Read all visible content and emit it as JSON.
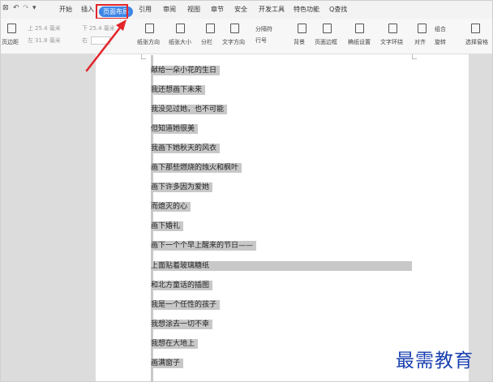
{
  "quick_access": {
    "undo": "↶",
    "redo": "↷",
    "more": "▾"
  },
  "menu_tabs": [
    "开始",
    "插入",
    "页面布局",
    "引用",
    "审阅",
    "视图",
    "章节",
    "安全",
    "开发工具",
    "特色功能",
    "Q查找"
  ],
  "active_tab": "页面布局",
  "ribbon": {
    "margins": "页边距",
    "top_label": "上",
    "top_value": "25.4 毫米",
    "bottom_label": "下",
    "bottom_value": "25.4 毫米",
    "left_label": "左",
    "left_value": "31.8 毫米",
    "right_label": "右",
    "orientation": "纸张方向",
    "size": "纸张大小",
    "columns": "分栏",
    "text_direction": "文字方向",
    "breaks": "分隔符",
    "line_numbers": "行号",
    "background": "背景",
    "page_border": "页面边框",
    "draft_settings": "稿纸设置",
    "text_wrap": "文字环绕",
    "align": "对齐",
    "group": "组合",
    "rotate": "旋转",
    "selection_pane": "选择窗格"
  },
  "document_lines": [
    "献给一朵小花的生日",
    "我还想画下未来",
    "我没见过她，也不可能",
    "但知道她很美",
    "我画下她秋天的风衣",
    "画下那些燃烧的烛火和枫叶",
    "画下许多因为爱她",
    "而熄灭的心",
    "画下婚礼",
    "画下一个个早上醒来的节日——",
    "上面贴着玻璃糖纸",
    "和北方童话的插图",
    "我是一个任性的孩子",
    "我想涂去一切不幸",
    "我想在大地上",
    "画满窗子"
  ],
  "watermark": "最需教育",
  "colors": {
    "active_tab": "#3d86e6",
    "highlight": "#e2262b",
    "selection": "#c8c8c8",
    "watermark": "#1a3fb0"
  }
}
